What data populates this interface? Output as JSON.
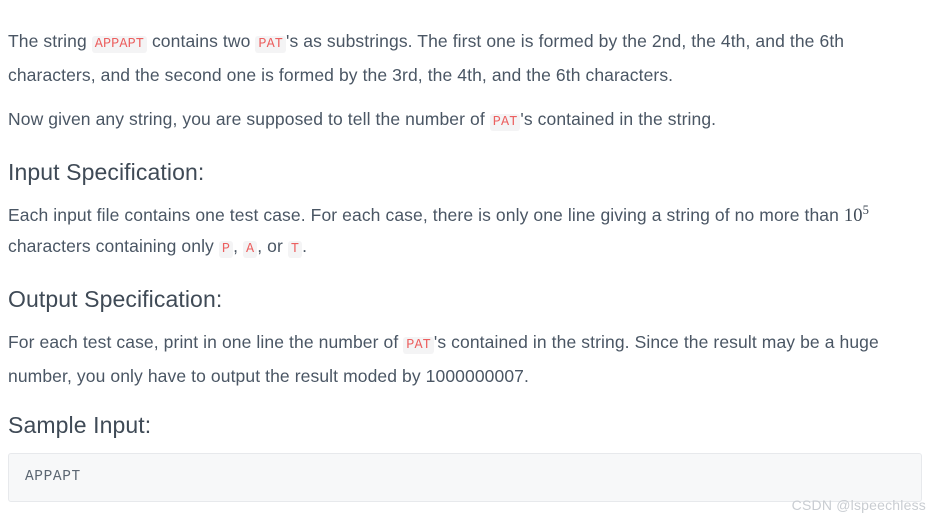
{
  "document": {
    "paragraphs": {
      "intro_part1": "The string ",
      "intro_code1": "APPAPT",
      "intro_part2": " contains two ",
      "intro_code2": "PAT",
      "intro_part3": "'s as substrings. The first one is formed by the 2nd, the 4th, and the 6th characters, and the second one is formed by the 3rd, the 4th, and the 6th characters.",
      "task_part1": "Now given any string, you are supposed to tell the number of ",
      "task_code1": "PAT",
      "task_part2": "'s contained in the string."
    },
    "input_section": {
      "heading": "Input Specification:",
      "body_part1": "Each input file contains one test case. For each case, there is only one line giving a string of no more than ",
      "math_base": "10",
      "math_exponent": "5",
      "body_part2": " characters containing only ",
      "char_p": "P",
      "separator1": ", ",
      "char_a": "A",
      "separator2": ", or ",
      "char_t": "T",
      "body_part3": "."
    },
    "output_section": {
      "heading": "Output Specification:",
      "body_part1": "For each test case, print in one line the number of ",
      "body_code1": "PAT",
      "body_part2": "'s contained in the string. Since the result may be a huge number, you only have to output the result moded by 1000000007."
    },
    "sample_input_section": {
      "heading": "Sample Input:",
      "code_block": "APPAPT"
    },
    "watermark": "CSDN @lspeechless",
    "colors": {
      "body_text": "#4a5664",
      "heading_text": "#3f4a56",
      "inline_code_text": "#ec6060",
      "inline_code_bg": "#f4f4f5",
      "code_block_bg": "#f7f8f9",
      "code_block_border": "#e7e9ec",
      "watermark_text": "#c9cdd2",
      "page_bg": "#ffffff"
    }
  }
}
